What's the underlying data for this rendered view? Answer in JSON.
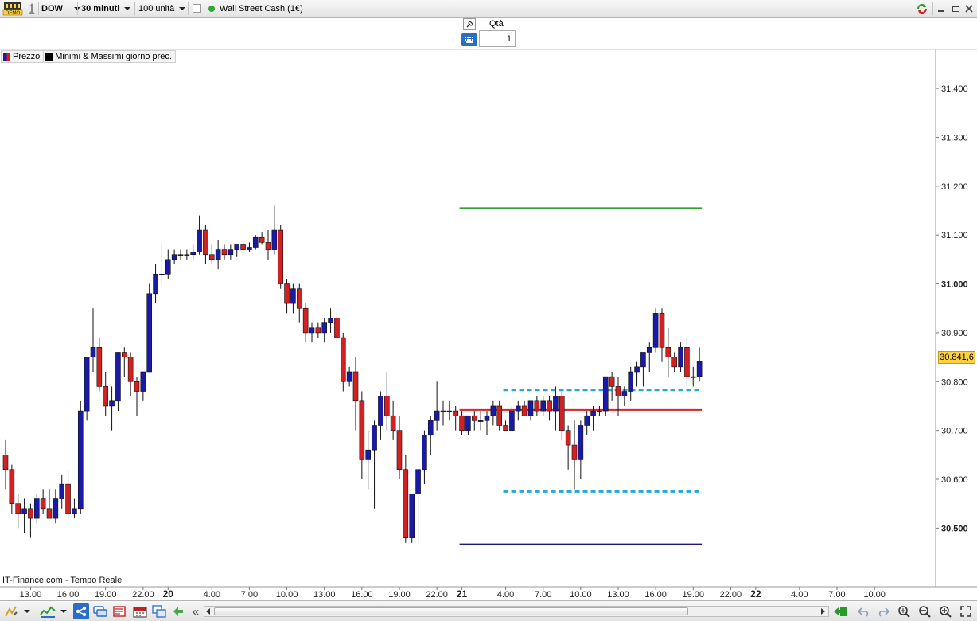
{
  "toolbar": {
    "demo_badge": "DEMO",
    "symbol": "DOW",
    "timeframe": "30 minuti",
    "units": "100 unità",
    "instrument": "Wall Street Cash (1€)",
    "status_color": "#2eaa2e"
  },
  "order_panel": {
    "qty_label": "Qtà",
    "qty_value": "1"
  },
  "legend": {
    "price_label": "Prezzo",
    "minmax_label": "Minimi & Massimi giorno prec."
  },
  "source_label": "IT-Finance.com - Tempo Reale",
  "price_badge": "30.841,6",
  "bottom_bar": {
    "scroll_left": "«"
  },
  "chart_data": {
    "type": "candlestick",
    "bar_interval": "30 minuti",
    "ylim": [
      30380,
      31480
    ],
    "y_ticks": [
      {
        "value": 31400,
        "label": "31.400",
        "bold": false
      },
      {
        "value": 31300,
        "label": "31.300",
        "bold": false
      },
      {
        "value": 31200,
        "label": "31.200",
        "bold": false
      },
      {
        "value": 31100,
        "label": "31.100",
        "bold": false
      },
      {
        "value": 31000,
        "label": "31.000",
        "bold": true
      },
      {
        "value": 30900,
        "label": "30.900",
        "bold": false
      },
      {
        "value": 30800,
        "label": "30.800",
        "bold": false
      },
      {
        "value": 30700,
        "label": "30.700",
        "bold": false
      },
      {
        "value": 30600,
        "label": "30.600",
        "bold": false
      },
      {
        "value": 30500,
        "label": "30.500",
        "bold": true
      }
    ],
    "x_ticks": [
      {
        "index": 4,
        "label": "13.00",
        "bold": false
      },
      {
        "index": 10,
        "label": "16.00",
        "bold": false
      },
      {
        "index": 16,
        "label": "19.00",
        "bold": false
      },
      {
        "index": 22,
        "label": "22.00",
        "bold": false
      },
      {
        "index": 26,
        "label": "20",
        "bold": true
      },
      {
        "index": 33,
        "label": "4.00",
        "bold": false
      },
      {
        "index": 39,
        "label": "7.00",
        "bold": false
      },
      {
        "index": 45,
        "label": "10.00",
        "bold": false
      },
      {
        "index": 51,
        "label": "13.00",
        "bold": false
      },
      {
        "index": 57,
        "label": "16.00",
        "bold": false
      },
      {
        "index": 63,
        "label": "19.00",
        "bold": false
      },
      {
        "index": 69,
        "label": "22.00",
        "bold": false
      },
      {
        "index": 73,
        "label": "21",
        "bold": true
      },
      {
        "index": 80,
        "label": "4.00",
        "bold": false
      },
      {
        "index": 86,
        "label": "7.00",
        "bold": false
      },
      {
        "index": 92,
        "label": "10.00",
        "bold": false
      },
      {
        "index": 98,
        "label": "13.00",
        "bold": false
      },
      {
        "index": 104,
        "label": "16.00",
        "bold": false
      },
      {
        "index": 110,
        "label": "19.00",
        "bold": false
      },
      {
        "index": 116,
        "label": "22.00",
        "bold": false
      },
      {
        "index": 120,
        "label": "22",
        "bold": true
      },
      {
        "index": 127,
        "label": "4.00",
        "bold": false
      },
      {
        "index": 133,
        "label": "7.00",
        "bold": false
      },
      {
        "index": 139,
        "label": "10.00",
        "bold": false
      }
    ],
    "up_color": "#1a1aa8",
    "down_color": "#d42020",
    "candles": [
      [
        30650,
        30680,
        30580,
        30620
      ],
      [
        30620,
        30630,
        30530,
        30550
      ],
      [
        30550,
        30570,
        30500,
        30530
      ],
      [
        30530,
        30560,
        30490,
        30540
      ],
      [
        30540,
        30550,
        30480,
        30520
      ],
      [
        30520,
        30570,
        30510,
        30560
      ],
      [
        30560,
        30580,
        30530,
        30540
      ],
      [
        30540,
        30580,
        30520,
        30520
      ],
      [
        30520,
        30580,
        30510,
        30560
      ],
      [
        30560,
        30610,
        30540,
        30590
      ],
      [
        30590,
        30620,
        30520,
        30530
      ],
      [
        30530,
        30560,
        30520,
        30540
      ],
      [
        30540,
        30760,
        30530,
        30740
      ],
      [
        30740,
        30850,
        30720,
        30850
      ],
      [
        30850,
        30950,
        30820,
        30870
      ],
      [
        30870,
        30890,
        30780,
        30790
      ],
      [
        30790,
        30820,
        30730,
        30750
      ],
      [
        30750,
        30790,
        30700,
        30760
      ],
      [
        30760,
        30860,
        30740,
        30860
      ],
      [
        30860,
        30870,
        30810,
        30850
      ],
      [
        30850,
        30860,
        30770,
        30800
      ],
      [
        30800,
        30810,
        30730,
        30780
      ],
      [
        30780,
        30810,
        30760,
        30820
      ],
      [
        30820,
        31000,
        30820,
        30980
      ],
      [
        30980,
        31040,
        30960,
        31020
      ],
      [
        31020,
        31080,
        31000,
        31020
      ],
      [
        31020,
        31070,
        31010,
        31050
      ],
      [
        31050,
        31070,
        31040,
        31060
      ],
      [
        31060,
        31070,
        31050,
        31060
      ],
      [
        31060,
        31070,
        31050,
        31060
      ],
      [
        31060,
        31080,
        31050,
        31065
      ],
      [
        31065,
        31140,
        31060,
        31110
      ],
      [
        31110,
        31120,
        31040,
        31060
      ],
      [
        31060,
        31080,
        31040,
        31050
      ],
      [
        31050,
        31090,
        31030,
        31070
      ],
      [
        31070,
        31080,
        31050,
        31060
      ],
      [
        31060,
        31080,
        31050,
        31070
      ],
      [
        31070,
        31080,
        31055,
        31080
      ],
      [
        31080,
        31085,
        31060,
        31070
      ],
      [
        31070,
        31085,
        31065,
        31075
      ],
      [
        31075,
        31100,
        31070,
        31095
      ],
      [
        31095,
        31105,
        31080,
        31085
      ],
      [
        31085,
        31110,
        31050,
        31070
      ],
      [
        31070,
        31160,
        31060,
        31110
      ],
      [
        31110,
        31120,
        30990,
        31000
      ],
      [
        31000,
        31010,
        30940,
        30960
      ],
      [
        30960,
        31000,
        30940,
        30990
      ],
      [
        30990,
        31000,
        30920,
        30950
      ],
      [
        30950,
        30960,
        30880,
        30900
      ],
      [
        30900,
        30920,
        30880,
        30910
      ],
      [
        30910,
        30920,
        30890,
        30900
      ],
      [
        30900,
        30930,
        30880,
        30920
      ],
      [
        30920,
        30950,
        30900,
        30930
      ],
      [
        30930,
        30940,
        30880,
        30890
      ],
      [
        30890,
        30900,
        30780,
        30800
      ],
      [
        30800,
        30830,
        30790,
        30820
      ],
      [
        30820,
        30850,
        30700,
        30760
      ],
      [
        30760,
        30780,
        30600,
        30640
      ],
      [
        30640,
        30700,
        30580,
        30660
      ],
      [
        30660,
        30720,
        30540,
        30710
      ],
      [
        30710,
        30780,
        30680,
        30770
      ],
      [
        30770,
        30820,
        30700,
        30730
      ],
      [
        30730,
        30760,
        30680,
        30700
      ],
      [
        30700,
        30730,
        30600,
        30620
      ],
      [
        30620,
        30650,
        30470,
        30480
      ],
      [
        30480,
        30560,
        30470,
        30570
      ],
      [
        30570,
        30620,
        30470,
        30620
      ],
      [
        30620,
        30700,
        30590,
        30690
      ],
      [
        30690,
        30730,
        30650,
        30720
      ],
      [
        30720,
        30800,
        30700,
        30740
      ],
      [
        30740,
        30760,
        30710,
        30740
      ],
      [
        30740,
        30760,
        30720,
        30740
      ],
      [
        30740,
        30750,
        30700,
        30730
      ],
      [
        30730,
        30740,
        30690,
        30700
      ],
      [
        30700,
        30730,
        30690,
        30730
      ],
      [
        30730,
        30740,
        30700,
        30720
      ],
      [
        30720,
        30740,
        30700,
        30720
      ],
      [
        30720,
        30740,
        30690,
        30730
      ],
      [
        30730,
        30760,
        30710,
        30750
      ],
      [
        30750,
        30760,
        30700,
        30710
      ],
      [
        30710,
        30720,
        30700,
        30700
      ],
      [
        30700,
        30750,
        30700,
        30740
      ],
      [
        30740,
        30760,
        30720,
        30750
      ],
      [
        30750,
        30760,
        30730,
        30730
      ],
      [
        30730,
        30760,
        30720,
        30760
      ],
      [
        30760,
        30770,
        30730,
        30740
      ],
      [
        30740,
        30770,
        30730,
        30760
      ],
      [
        30760,
        30770,
        30720,
        30740
      ],
      [
        30740,
        30790,
        30700,
        30770
      ],
      [
        30770,
        30780,
        30680,
        30700
      ],
      [
        30700,
        30710,
        30620,
        30670
      ],
      [
        30670,
        30720,
        30580,
        30640
      ],
      [
        30640,
        30720,
        30600,
        30710
      ],
      [
        30710,
        30740,
        30690,
        30730
      ],
      [
        30730,
        30750,
        30700,
        30740
      ],
      [
        30740,
        30750,
        30730,
        30740
      ],
      [
        30740,
        30810,
        30730,
        30810
      ],
      [
        30810,
        30820,
        30760,
        30790
      ],
      [
        30790,
        30810,
        30730,
        30770
      ],
      [
        30770,
        30790,
        30750,
        30780
      ],
      [
        30780,
        30830,
        30760,
        30820
      ],
      [
        30820,
        30840,
        30790,
        30830
      ],
      [
        30830,
        30860,
        30790,
        30860
      ],
      [
        30860,
        30880,
        30820,
        30870
      ],
      [
        30870,
        30950,
        30860,
        30940
      ],
      [
        30940,
        30950,
        30840,
        30870
      ],
      [
        30870,
        30910,
        30810,
        30850
      ],
      [
        30850,
        30860,
        30820,
        30830
      ],
      [
        30830,
        30880,
        30820,
        30870
      ],
      [
        30870,
        30890,
        30790,
        30810
      ],
      [
        30810,
        30830,
        30790,
        30810
      ],
      [
        30810,
        30870,
        30800,
        30842
      ]
    ],
    "levels": [
      {
        "name": "prev-day-high",
        "value": 31155,
        "from_index": 73,
        "to_index": 111,
        "color": "#2ea02e",
        "style": "solid"
      },
      {
        "name": "pivot-red",
        "value": 30742,
        "from_index": 73,
        "to_index": 111,
        "color": "#e02020",
        "style": "solid"
      },
      {
        "name": "range-top",
        "value": 30783,
        "from_index": 80,
        "to_index": 111,
        "color": "#22aadd",
        "style": "dashed"
      },
      {
        "name": "range-bottom",
        "value": 30575,
        "from_index": 80,
        "to_index": 111,
        "color": "#22aadd",
        "style": "dashed"
      },
      {
        "name": "prev-day-low",
        "value": 30467,
        "from_index": 73,
        "to_index": 111,
        "color": "#1a1a80",
        "style": "solid"
      }
    ],
    "current_price": 30841.6
  }
}
